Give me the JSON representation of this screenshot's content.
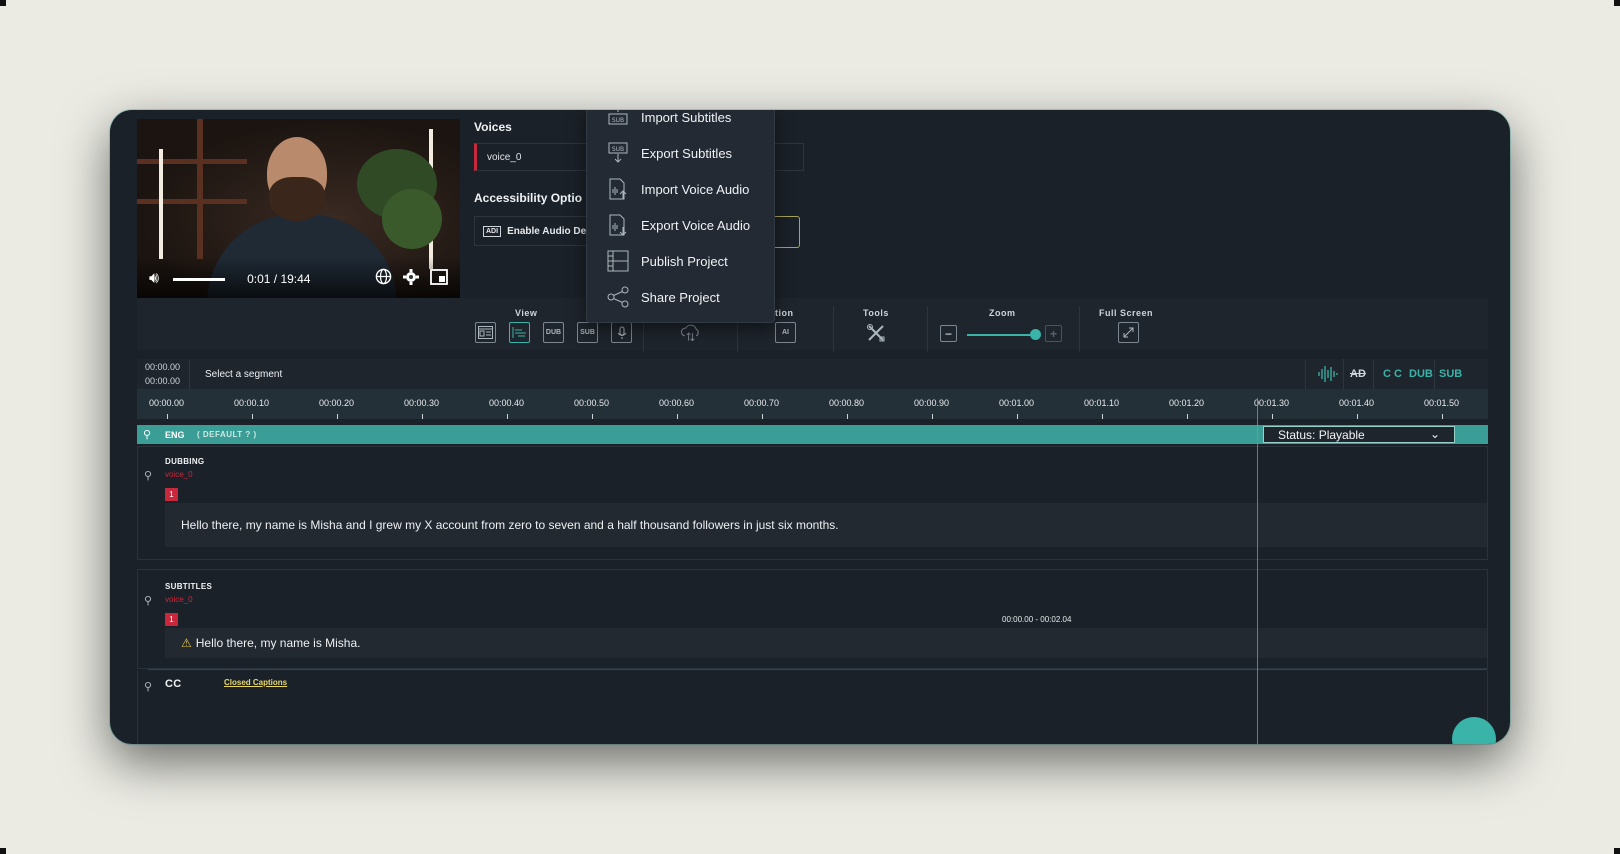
{
  "video": {
    "time": "0:01 / 19:44",
    "icons": [
      "volume-icon",
      "globe-icon",
      "settings-icon",
      "miniplayer-icon"
    ]
  },
  "voices": {
    "heading": "Voices",
    "selected": "voice_0"
  },
  "accessibility": {
    "heading": "Accessibility Optio",
    "ad_label": "Enable Audio De",
    "ad_badge": "ADI"
  },
  "menu": {
    "items": [
      "Import Subtitles",
      "Export Subtitles",
      "Import Voice Audio",
      "Export Voice Audio",
      "Publish Project",
      "Share Project"
    ],
    "sub_badge": "SUB"
  },
  "toolbar": {
    "view_label": "View",
    "automation_label": "mation",
    "tools_label": "Tools",
    "zoom_label": "Zoom",
    "fullscreen_label": "Full Screen",
    "dub_icon": "DUB",
    "sub_icon": "SUB",
    "ai_icon": "AI",
    "zoom_level": 0.85
  },
  "segment_bar": {
    "time_top": "00:00.00",
    "time_bottom": "00:00.00",
    "label": "Select a segment",
    "modes": [
      "AD",
      "C C",
      "DUB",
      "SUB"
    ]
  },
  "ruler": {
    "ticks": [
      "00:00.00",
      "00:00.10",
      "00:00.20",
      "00:00.30",
      "00:00.40",
      "00:00.50",
      "00:00.60",
      "00:00.70",
      "00:00.80",
      "00:00.90",
      "00:01.00",
      "00:01.10",
      "00:01.20",
      "00:01.30",
      "00:01.40",
      "00:01.50"
    ]
  },
  "language": {
    "code": "ENG",
    "default_text": "( DEFAULT ? )",
    "status": "Status: Playable"
  },
  "dubbing": {
    "title": "DUBBING",
    "voice": "voice_0",
    "segment_number": "1",
    "text": "Hello there, my name is Misha and I grew my X account from zero to seven and a half thousand followers in just six months."
  },
  "subtitles": {
    "title": "SUBTITLES",
    "voice": "voice_0",
    "segment_number": "1",
    "range": "00:00.00 - 00:02.04",
    "text": "Hello there, my name is Misha.",
    "warning_icon": "⚠"
  },
  "cc": {
    "title": "CC",
    "link": "Closed Captions"
  }
}
